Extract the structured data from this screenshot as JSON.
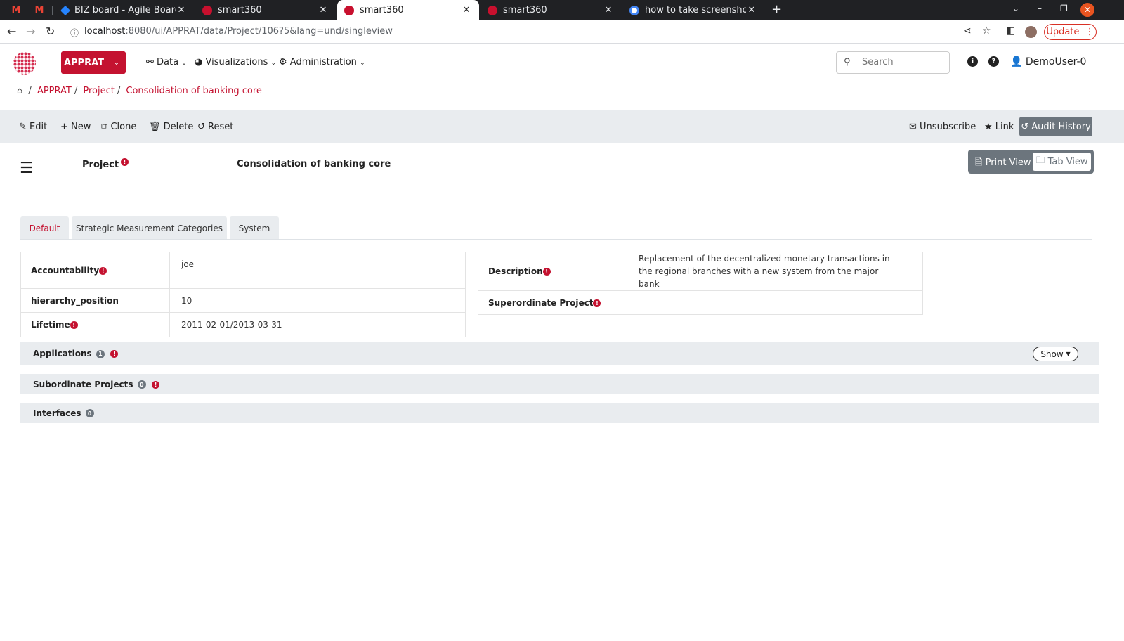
{
  "browser": {
    "tabs": [
      {
        "label": "BIZ board - Agile Board - J"
      },
      {
        "label": "smart360"
      },
      {
        "label": "smart360"
      },
      {
        "label": "smart360"
      },
      {
        "label": "how to take screenshot in"
      }
    ],
    "url": "localhost",
    "url_rest": ":8080/ui/APPRAT/data/Project/106?5&lang=und/singleview",
    "update_label": "Update"
  },
  "header": {
    "app_name": "APPRAT",
    "nav": [
      {
        "label": "Data",
        "icon": "sitemap-icon"
      },
      {
        "label": "Visualizations",
        "icon": "pie-chart-icon"
      },
      {
        "label": "Administration",
        "icon": "gears-icon"
      }
    ],
    "search_placeholder": "Search",
    "user": "DemoUser-0"
  },
  "breadcrumb": {
    "items": [
      "APPRAT",
      "Project",
      "Consolidation of banking core"
    ]
  },
  "toolbar": {
    "edit": "Edit",
    "new": "New",
    "clone": "Clone",
    "delete": "Delete",
    "reset": "Reset",
    "unsubscribe": "Unsubscribe",
    "link": "Link",
    "audit_history": "Audit History"
  },
  "object": {
    "type": "Project",
    "name": "Consolidation of banking core",
    "print_view": "Print View",
    "tab_view": "Tab View"
  },
  "tabs": [
    "Default",
    "Strategic Measurement Categories",
    "System"
  ],
  "left_fields": [
    {
      "label": "Accountability",
      "value": "joe"
    },
    {
      "label": "hierarchy_position",
      "value": "10"
    },
    {
      "label": "Lifetime",
      "value": "2011-02-01/2013-03-31"
    }
  ],
  "right_fields": [
    {
      "label": "Description",
      "value": "Replacement of the decentralized monetary transactions in the regional branches with a new system from the major bank"
    },
    {
      "label": "Superordinate Project",
      "value": ""
    }
  ],
  "sections": [
    {
      "label": "Applications",
      "count": "1",
      "action": "Show"
    },
    {
      "label": "Subordinate Projects",
      "count": "0"
    },
    {
      "label": "Interfaces",
      "count": "0"
    }
  ],
  "colors": {
    "brand": "#c41230",
    "toolbar_bg": "#e9ecef"
  }
}
